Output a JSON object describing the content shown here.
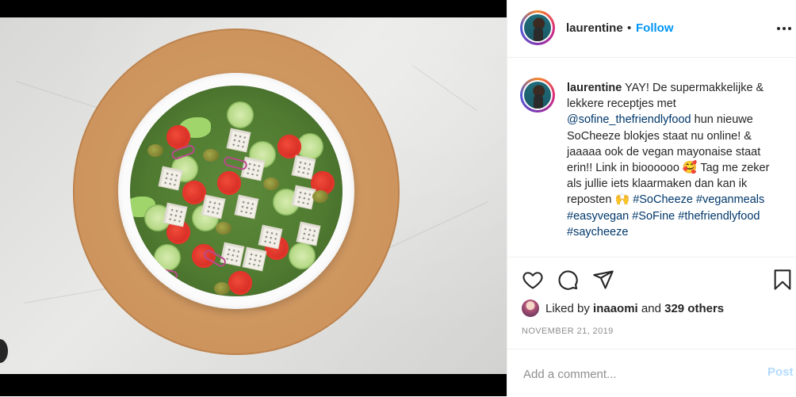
{
  "post": {
    "username": "laurentine",
    "separator": "•",
    "follow_label": "Follow",
    "more_icon": "more-horizontal-icon",
    "caption": {
      "username": "laurentine",
      "segments": [
        {
          "text": " YAY! De supermakkelijke & lekkere receptjes met ",
          "type": "text"
        },
        {
          "text": "@sofine_thefriendlyfood",
          "type": "link"
        },
        {
          "text": " hun nieuwe SoCheeze blokjes staat nu online! & jaaaaa ook de vegan mayonaise staat erin!! Link in bioooooo ",
          "type": "text"
        },
        {
          "text": "🥰",
          "type": "emoji"
        },
        {
          "text": " Tag me zeker als jullie iets klaarmaken dan kan ik reposten ",
          "type": "text"
        },
        {
          "text": "🙌",
          "type": "emoji"
        },
        {
          "text": " ",
          "type": "text"
        },
        {
          "text": "#SoCheeze",
          "type": "link"
        },
        {
          "text": " ",
          "type": "text"
        },
        {
          "text": "#veganmeals",
          "type": "link"
        },
        {
          "text": " ",
          "type": "text"
        },
        {
          "text": "#easyvegan",
          "type": "link"
        },
        {
          "text": " ",
          "type": "text"
        },
        {
          "text": "#SoFine",
          "type": "link"
        },
        {
          "text": " ",
          "type": "text"
        },
        {
          "text": "#thefriendlyfood",
          "type": "link"
        },
        {
          "text": " ",
          "type": "text"
        },
        {
          "text": "#saycheeze",
          "type": "link"
        }
      ]
    },
    "actions": {
      "like_icon": "heart-icon",
      "comment_icon": "comment-icon",
      "share_icon": "share-icon",
      "save_icon": "bookmark-icon"
    },
    "likes": {
      "prefix": "Liked by ",
      "liker": "inaaomi",
      "middle": " and ",
      "others": "329 others"
    },
    "date": "NOVEMBER 21, 2019",
    "comment": {
      "placeholder": "Add a comment...",
      "post_label": "Post"
    }
  },
  "colors": {
    "accent": "#0095f6",
    "link": "#00376b",
    "muted": "#8e8e8e",
    "post_disabled": "#b3dbff"
  }
}
